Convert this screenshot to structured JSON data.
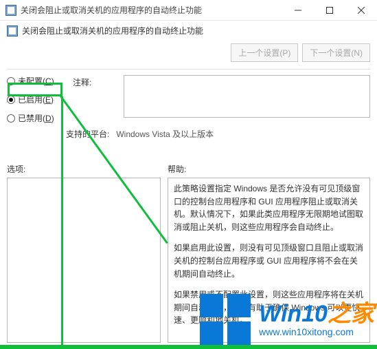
{
  "window": {
    "title": "关闭会阻止或取消关机的应用程序的自动终止功能"
  },
  "header": {
    "subtitle": "关闭会阻止或取消关机的应用程序的自动终止功能",
    "prev_btn": "上一个设置(P)",
    "next_btn": "下一个设置(N)"
  },
  "radios": {
    "not_configured": "未配置",
    "not_configured_key": "C",
    "enabled": "已启用",
    "enabled_key": "E",
    "disabled": "已禁用",
    "disabled_key": "D",
    "selected": "enabled"
  },
  "labels": {
    "comment": "注释:",
    "platform": "支持的平台:",
    "options": "选项:",
    "help": "帮助:"
  },
  "fields": {
    "comment_value": "",
    "platform_value": "Windows Vista 及以上版本"
  },
  "help": {
    "p1": "此策略设置指定 Windows 是否允许没有可见顶级窗口的控制台应用程序和 GUI 应用程序阻止或取消关机。默认情况下，如果此类应用程序无限期地试图取消或阻止关机，则这些应用程序会自动终止。",
    "p2": "如果启用此设置，则没有可见顶级窗口且阻止或取消关机的控制台应用程序或 GUI 应用程序将不会在关机期间自动终止。",
    "p3": "如果禁用或不配置此设置，则这些应用程序将在关机期间自动终止，从而有助于确保 Windows 可以更快速、更顺利地关机。"
  },
  "watermark": {
    "brand_a": "Win10",
    "brand_b": "之家",
    "url": "www.win10xitong.com"
  }
}
